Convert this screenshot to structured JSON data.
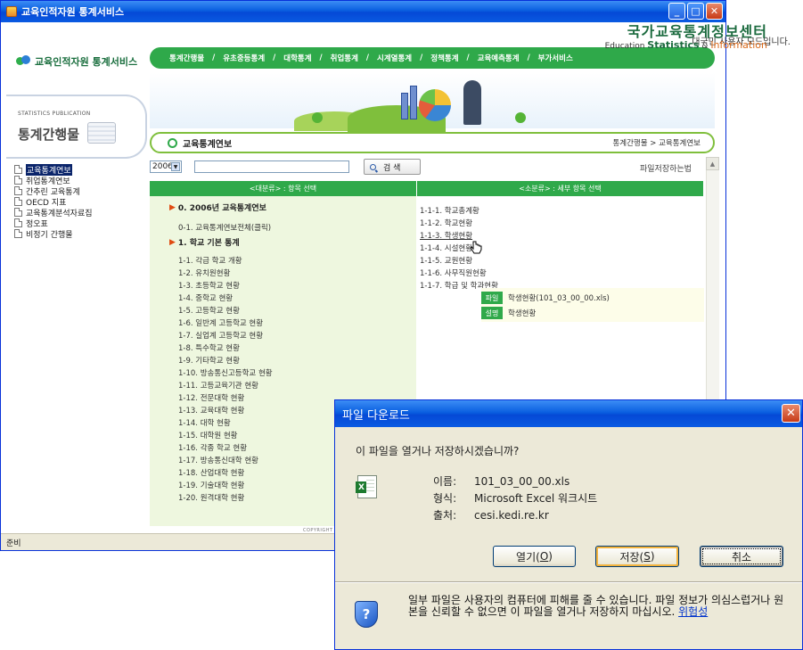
{
  "main_window": {
    "title": "교육인적자원 통계서비스",
    "user_mode": "대국민 사용자 모드입니다.",
    "logo_text": "교육인적자원 통계서비스",
    "nav": [
      "통계간행물",
      "유초중등통계",
      "대학통계",
      "취업통계",
      "시계열통계",
      "정책통계",
      "교육예측통계",
      "부가서비스"
    ],
    "banner": {
      "title": "국가교육통계정보센터",
      "sub_pre": "Education ",
      "sub_mid": "Statistics",
      "sub_and": " & ",
      "sub_end": "Information"
    },
    "sidebar": {
      "sub": "STATISTICS PUBLICATION",
      "title": "통계간행물",
      "items": [
        {
          "label": "교육통계연보",
          "selected": true
        },
        {
          "label": "취업통계연보"
        },
        {
          "label": "간추린 교육통계"
        },
        {
          "label": "OECD 지표"
        },
        {
          "label": "교육통계분석자료집"
        },
        {
          "label": "정오표"
        },
        {
          "label": "비정기 간행물"
        }
      ]
    },
    "page_title": "교육통계연보",
    "breadcrumb": "통계간행물 > 교육통계연보",
    "year": "2006",
    "search_label": "검 색",
    "save_method": "파일저장하는법",
    "left_header": "<대분류> : 항목 선택",
    "right_header": "<소분류> : 세부 항목 선택",
    "left_groups": [
      {
        "head": "0. 2006년 교육통계연보",
        "items": [
          "0-1. 교육통계연보전체(클릭)"
        ]
      },
      {
        "head": "1. 학교 기본 통계",
        "items": [
          "1-1. 각급 학교 개황",
          "1-2. 유치원현황",
          "1-3. 초등학교 현황",
          "1-4. 중학교 현황",
          "1-5. 고등학교 현황",
          "1-6. 일반계 고등학교 현황",
          "1-7. 실업계 고등학교 현황",
          "1-8. 특수학교 현황",
          "1-9. 기타학교 현황",
          "1-10. 방송통신고등학교 현황",
          "1-11. 고등교육기관 현황",
          "1-12. 전문대학 현황",
          "1-13. 교육대학 현황",
          "1-14. 대학 현황",
          "1-15. 대학원 현황",
          "1-16. 각종 학교 현황",
          "1-17. 방송통신대학 현황",
          "1-18. 산업대학 현황",
          "1-19. 기술대학 현황",
          "1-20. 원격대학 현황"
        ]
      }
    ],
    "right_items": [
      "1-1-1. 학교총계황",
      "1-1-2. 학교현황",
      "1-1-3. 학생현황",
      "1-1-4. 시설현황",
      "1-1-5. 교원현황",
      "1-1-6. 사무직원현황",
      "1-1-7. 학급 및 학과현황"
    ],
    "file_popup": {
      "file_tag": "파일",
      "file_text": "학생현황(101_03_00_00.xls)",
      "desc_tag": "설명",
      "desc_text": "학생현황"
    },
    "copyright": "COPYRIGHT",
    "status": "준비"
  },
  "dialog": {
    "title": "파일 다운로드",
    "question": "이 파일을 열거나 저장하시겠습니까?",
    "name_label": "이름:",
    "name_value": "101_03_00_00.xls",
    "type_label": "형식:",
    "type_value": "Microsoft Excel 워크시트",
    "from_label": "출처:",
    "from_value": "cesi.kedi.re.kr",
    "open_label": "열기(",
    "open_key": "O",
    "save_label": "저장(",
    "save_key": "S",
    "cancel_label": "취소",
    "warning": "일부 파일은 사용자의 컴퓨터에 피해를 줄 수 있습니다. 파일 정보가 의심스럽거나 원본을 신뢰할 수 없으면 이 파일을 열거나 저장하지 마십시오.",
    "risk_link": "위험성"
  }
}
